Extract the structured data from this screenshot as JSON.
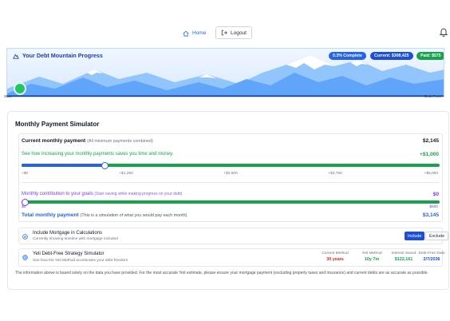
{
  "nav": {
    "home_label": "Home",
    "logout_label": "Logout"
  },
  "banner": {
    "title": "Your Debt Mountain Progress",
    "complete_pill": "0.3% Complete",
    "current_pill": "Current: $308,425",
    "paid_pill": "Paid: $575",
    "start_label": "Start",
    "end_label": "Debt Free!"
  },
  "simulator": {
    "title": "Monthly Payment Simulator",
    "current_label": "Current monthly payment",
    "current_sub": "(All minimum payments combined)",
    "current_value": "$2,145",
    "see_how": "See how increasing your monthly payments saves you time and money.",
    "increase_value": "+$1,000",
    "increase_slider_fraction": 0.2,
    "increase_ticks": [
      "+$0",
      "+$1,250",
      "+$2,500",
      "+$3,750",
      "+$5,000"
    ],
    "contrib_label": "Monthly contribution to your goals",
    "contrib_sub": "(Start saving while making progress on your debt)",
    "contrib_value": "$0",
    "contrib_slider_fraction": 0,
    "contrib_ticks": [
      "$0",
      "$500"
    ],
    "total_label": "Total monthly payment",
    "total_sub": "(This is a simulation of what you would pay each month)",
    "total_value": "$3,145"
  },
  "mortgage": {
    "title": "Include Mortgage in Calculations",
    "sub": "Currently showing timeline with mortgage included",
    "include_label": "Include",
    "exclude_label": "Exclude"
  },
  "strategy": {
    "title": "Yeti Debt-Free Strategy Simulator",
    "sub": "See how the Yeti Method accelerates your debt freedom",
    "stats": [
      {
        "label": "Current Method",
        "value": "30 years",
        "color": "#dc2626"
      },
      {
        "label": "Yeti Method",
        "value": "10y 7m",
        "color": "#16a34a"
      },
      {
        "label": "Interest Saved",
        "value": "$122,161",
        "color": "#16a34a"
      },
      {
        "label": "Debt-Free Date",
        "value": "2/7/2036",
        "color": "#1d4ed8"
      }
    ]
  },
  "disclaimer": "The information above is based solely on the data you have provided. For the most accurate Yeti estimate, please ensure your mortgage payment (excluding property taxes and insurance) and current debts are as accurate as possible.",
  "colors": {
    "primary": "#2563eb",
    "success": "#16a34a",
    "purple": "#7c3aed",
    "danger": "#dc2626"
  }
}
